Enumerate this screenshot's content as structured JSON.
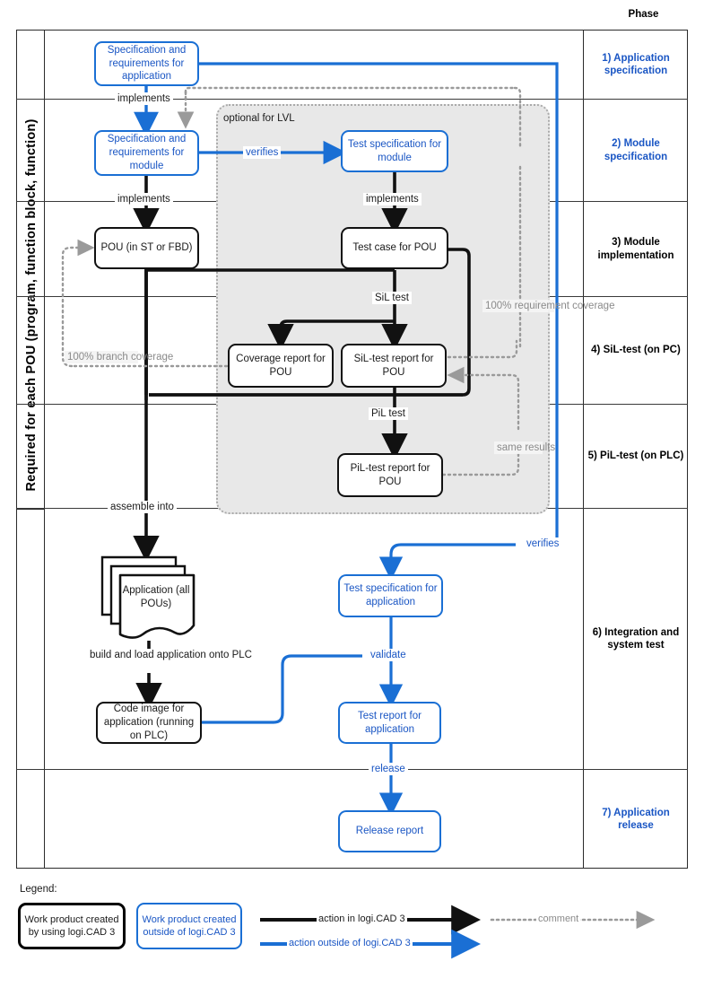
{
  "header": {
    "phase_column_title": "Phase"
  },
  "side_label": "Required for each POU (program, function block, function)",
  "grey_region": {
    "label": "optional for LVL"
  },
  "phases": [
    {
      "label": "1) Application specification",
      "style": "blue"
    },
    {
      "label": "2) Module specification",
      "style": "blue"
    },
    {
      "label": "3) Module implementation",
      "style": "black"
    },
    {
      "label": "4) SiL-test (on PC)",
      "style": "black"
    },
    {
      "label": "5) PiL-test (on PLC)",
      "style": "black"
    },
    {
      "label": "6) Integration and system test",
      "style": "black"
    },
    {
      "label": "7) Application release",
      "style": "blue"
    }
  ],
  "nodes": {
    "spec_application": "Specification and requirements for application",
    "spec_module": "Specification and requirements for module",
    "test_spec_module": "Test specification for module",
    "pou": "POU (in ST or FBD)",
    "test_case_pou": "Test case for POU",
    "coverage_report_pou": "Coverage report for POU",
    "sil_test_report_pou": "SiL-test report for POU",
    "pil_test_report_pou": "PiL-test report for POU",
    "application_all_pous": "Application (all POUs)",
    "code_image_application": "Code image for application (running on PLC)",
    "test_spec_application": "Test specification for application",
    "test_report_application": "Test report for application",
    "release_report": "Release report"
  },
  "edge_labels": {
    "implements_1": "implements",
    "implements_2": "implements",
    "implements_3": "implements",
    "verifies_module": "verifies",
    "verifies_application": "verifies",
    "sil_test": "SiL test",
    "pil_test": "PiL test",
    "assemble_into": "assemble into",
    "build_and_load": "build and load application onto PLC",
    "validate": "validate",
    "release": "release"
  },
  "comments": {
    "branch_coverage": "100% branch coverage",
    "requirement_coverage": "100% requirement coverage",
    "same_results": "same results"
  },
  "legend": {
    "title": "Legend:",
    "work_product_inside": "Work product created by using logi.CAD 3",
    "work_product_outside": "Work product created outside of logi.CAD 3",
    "action_inside": "action in logi.CAD 3",
    "action_outside": "action outside of logi.CAD 3",
    "comment": "comment"
  },
  "colors": {
    "blue": "#1a6fd4",
    "blue_text": "#1a56c4",
    "black": "#111111",
    "grey": "#aaaaaa",
    "grey_fill": "#e8e8e8"
  }
}
